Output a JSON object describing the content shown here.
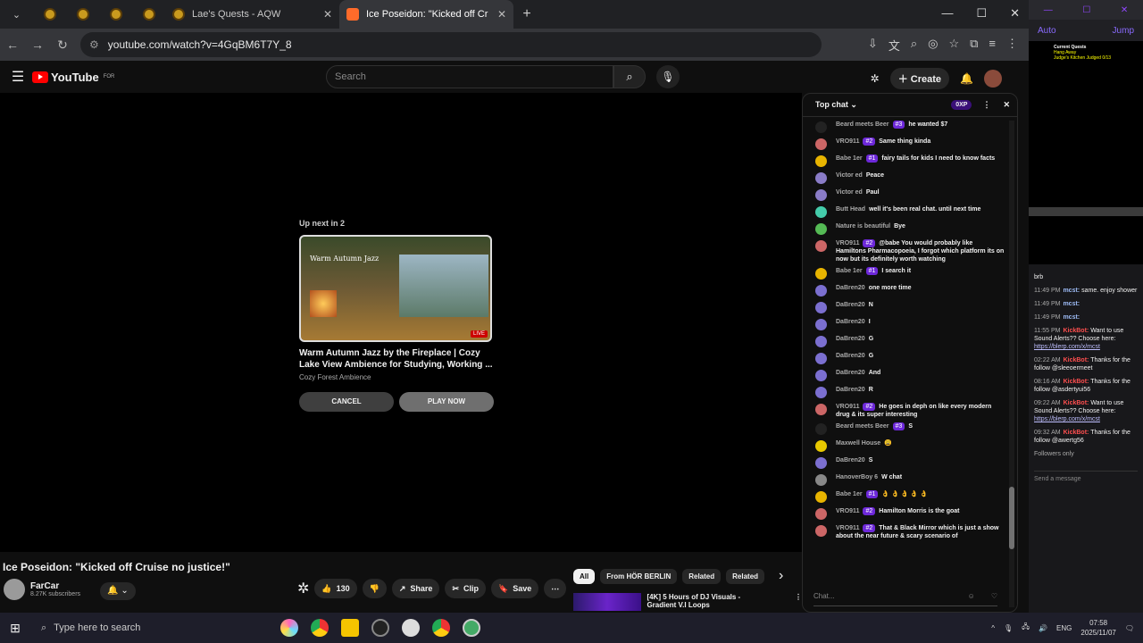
{
  "browser": {
    "tabs": [
      {
        "label": ""
      },
      {
        "label": ""
      },
      {
        "label": ""
      },
      {
        "label": ""
      },
      {
        "label": "Lae's Quests - AQW"
      },
      {
        "label": "Ice Poseidon: \"Kicked off Cr"
      }
    ],
    "url": "youtube.com/watch?v=4GqBM6T7Y_8"
  },
  "youtube": {
    "logo": "YouTube",
    "logo_sup": "FOR",
    "search_placeholder": "Search",
    "create_label": "Create",
    "up_next": "Up next in 2",
    "next_title": "Warm Autumn Jazz by the Fireplace | Cozy Lake View Ambience for Studying, Working ...",
    "next_channel": "Cozy Forest Ambience",
    "thumb_text": "Warm Autumn Jazz",
    "live": "LIVE",
    "cancel": "CANCEL",
    "play_now": "PLAY NOW",
    "video_title": "Ice Poseidon: \"Kicked off Cruise no justice!\"",
    "channel": "FarCar",
    "subs": "8.27K subscribers",
    "likes": "130",
    "share": "Share",
    "clip": "Clip",
    "save": "Save",
    "chips": [
      "All",
      "From HÖR BERLIN",
      "Related",
      "Related"
    ],
    "rec_title": "[4K] 5 Hours of DJ Visuals - Gradient V.I Loops"
  },
  "chat": {
    "title": "Top chat",
    "xp": "0XP",
    "input_placeholder": "Chat...",
    "messages": [
      {
        "author": "Beard meets Beer",
        "badge": "#3",
        "text": "he wanted $7",
        "color": "#222"
      },
      {
        "author": "VRO911",
        "badge": "#2",
        "text": "Same thing kinda",
        "color": "#c66"
      },
      {
        "author": "Babe 1er",
        "badge": "#1",
        "text": "fairy tails for kids I need to know facts",
        "color": "#e8b400"
      },
      {
        "author": "Victor ed",
        "badge": "",
        "text": "Peace",
        "color": "#8a7cc7"
      },
      {
        "author": "Victor ed",
        "badge": "",
        "text": "Paul",
        "color": "#8a7cc7"
      },
      {
        "author": "Butt Head",
        "badge": "",
        "text": "well it's been real chat. until next time",
        "color": "#4ca"
      },
      {
        "author": "Nature is beautiful",
        "badge": "",
        "text": "Bye",
        "color": "#5b5"
      },
      {
        "author": "VRO911",
        "badge": "#2",
        "text": "@babe You would probably like Hamiltons Pharmacopoeia, I forgot which platform its on now but its definitely worth watching",
        "color": "#c66"
      },
      {
        "author": "Babe 1er",
        "badge": "#1",
        "text": "I search it",
        "color": "#e8b400"
      },
      {
        "author": "DaBren20",
        "badge": "",
        "text": "one more time",
        "color": "#7b6fd0"
      },
      {
        "author": "DaBren20",
        "badge": "",
        "text": "N",
        "color": "#7b6fd0"
      },
      {
        "author": "DaBren20",
        "badge": "",
        "text": "I",
        "color": "#7b6fd0"
      },
      {
        "author": "DaBren20",
        "badge": "",
        "text": "G",
        "color": "#7b6fd0"
      },
      {
        "author": "DaBren20",
        "badge": "",
        "text": "G",
        "color": "#7b6fd0"
      },
      {
        "author": "DaBren20",
        "badge": "",
        "text": "And",
        "color": "#7b6fd0"
      },
      {
        "author": "DaBren20",
        "badge": "",
        "text": "R",
        "color": "#7b6fd0"
      },
      {
        "author": "VRO911",
        "badge": "#2",
        "text": "He goes in deph on like every modern drug & its super interesting",
        "color": "#c66"
      },
      {
        "author": "Beard meets Beer",
        "badge": "#3",
        "text": "S",
        "color": "#222"
      },
      {
        "author": "Maxwell House",
        "badge": "",
        "text": "😩",
        "color": "#e8c800"
      },
      {
        "author": "DaBren20",
        "badge": "",
        "text": "S",
        "color": "#7b6fd0"
      },
      {
        "author": "HanoverBoy 6",
        "badge": "",
        "text": "W chat",
        "color": "#888"
      },
      {
        "author": "Babe 1er",
        "badge": "#1",
        "text": "👌 👌 👌 👌 👌",
        "color": "#e8b400"
      },
      {
        "author": "VRO911",
        "badge": "#2",
        "text": "Hamilton Morris is the goat",
        "color": "#c66"
      },
      {
        "author": "VRO911",
        "badge": "#2",
        "text": "That & Black Mirror which is just a show about the near future & scary scenario of",
        "color": "#c66"
      }
    ]
  },
  "twitch": {
    "auto": "Auto",
    "jump": "Jump",
    "quest_title": "Current Quests",
    "quest_lines": [
      "Hang Away",
      "Judge's Kitchen Judged 0/13"
    ],
    "msgs": [
      {
        "time": "",
        "user": "",
        "text": "brb",
        "kick": false
      },
      {
        "time": "11:49 PM",
        "user": "mcst:",
        "text": "same. enjoy shower",
        "kick": false
      },
      {
        "time": "11:49 PM",
        "user": "mcst:",
        "text": "",
        "kick": false
      },
      {
        "time": "11:49 PM",
        "user": "mcst:",
        "text": "",
        "kick": false
      },
      {
        "time": "11:55 PM",
        "user": "KickBot:",
        "text": "Want to use Sound Alerts?? Choose here:",
        "link": "https://blerp.com/x/mcst",
        "kick": true
      },
      {
        "time": "02:22 AM",
        "user": "KickBot:",
        "text": "Thanks for the follow @sleeoermeet",
        "kick": true
      },
      {
        "time": "08:16 AM",
        "user": "KickBot:",
        "text": "Thanks for the follow @asdertyui56",
        "kick": true
      },
      {
        "time": "09:22 AM",
        "user": "KickBot:",
        "text": "Want to use Sound Alerts?? Choose here:",
        "link": "https://blerp.com/x/mcst",
        "kick": true
      },
      {
        "time": "09:32 AM",
        "user": "KickBot:",
        "text": "Thanks for the follow @awertg56",
        "kick": true
      }
    ],
    "followers_only": "Followers only",
    "send": "Send a message"
  },
  "taskbar": {
    "search": "Type here to search",
    "lang": "ENG",
    "time": "07:58",
    "date": "2025/11/07"
  }
}
